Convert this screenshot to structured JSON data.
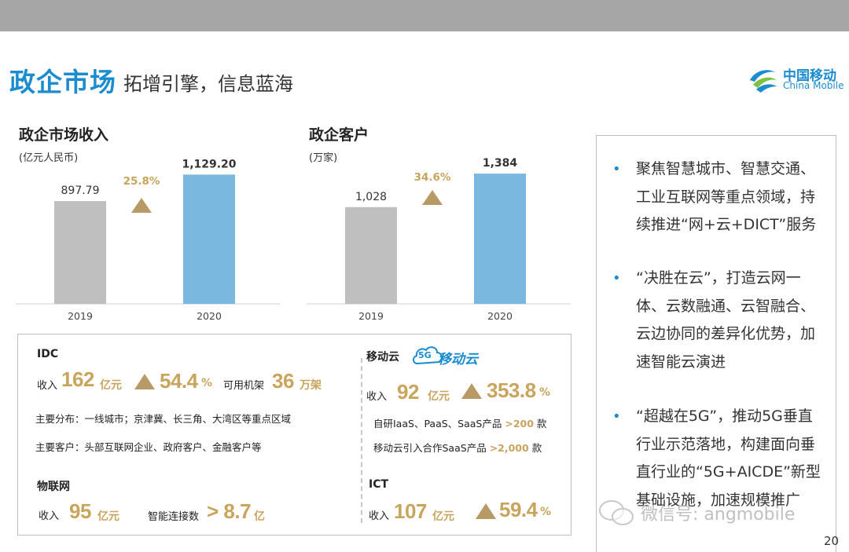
{
  "header": {
    "title_main": "政企市场",
    "title_sub": "拓增引擎，信息蓝海",
    "logo_cn": "中国移动",
    "logo_en": "China Mobile"
  },
  "chart_data": [
    {
      "type": "bar",
      "title": "政企市场收入",
      "ylabel": "(亿元人民币)",
      "categories": [
        "2019",
        "2020"
      ],
      "values": [
        897.79,
        1129.2
      ],
      "value_labels": [
        "897.79",
        "1,129.20"
      ],
      "growth": "25.8%",
      "colors": [
        "#bfbfbf",
        "#7ab8e0"
      ],
      "ylim": [
        0,
        1200
      ]
    },
    {
      "type": "bar",
      "title": "政企客户",
      "ylabel": "(万家)",
      "categories": [
        "2019",
        "2020"
      ],
      "values": [
        1028,
        1384
      ],
      "value_labels": [
        "1,028",
        "1,384"
      ],
      "growth": "34.6%",
      "colors": [
        "#bfbfbf",
        "#7ab8e0"
      ],
      "ylim": [
        0,
        1460
      ]
    }
  ],
  "idc": {
    "title": "IDC",
    "revenue_label": "收入",
    "revenue_value": "162",
    "revenue_unit": "亿元",
    "growth_value": "54.4",
    "growth_unit": "%",
    "racks_label": "可用机架",
    "racks_value": "36",
    "racks_unit": "万架",
    "distribution": "主要分布：一线城市；京津冀、长三角、大湾区等重点区域",
    "customers": "主要客户：头部互联网企业、政府客户、金融客户等"
  },
  "iot": {
    "title": "物联网",
    "revenue_label": "收入",
    "revenue_value": "95",
    "revenue_unit": "亿元",
    "connections_label": "智能连接数",
    "connections_value": "> 8.7",
    "connections_unit": "亿"
  },
  "cloud": {
    "title": "移动云",
    "logo_text": "移动云",
    "logo_badge": "5G",
    "revenue_label": "收入",
    "revenue_value": "92",
    "revenue_unit": "亿元",
    "growth_value": "353.8",
    "growth_unit": "%",
    "line1_text": "自研IaaS、PaaS、SaaS产品",
    "line1_value": ">200",
    "line1_unit": "款",
    "line2_text": "移动云引入合作SaaS产品",
    "line2_value": ">2,000",
    "line2_unit": "款"
  },
  "ict": {
    "title": "ICT",
    "revenue_label": "收入",
    "revenue_value": "107",
    "revenue_unit": "亿元",
    "growth_value": "59.4",
    "growth_unit": "%"
  },
  "side": {
    "bullets": [
      "聚焦智慧城市、智慧交通、工业互联网等重点领域，持续推进“网+云+DICT”服务",
      "“决胜在云”，打造云网一体、云数融通、云智融合、云边协同的差异化优势，加速智能云演进",
      "“超越在5G”，推动5G垂直行业示范落地，构建面向垂直行业的“5G+AICDE”新型基础设施，加速规模推广"
    ]
  },
  "watermark": "微信号: angmobile",
  "page_number": "20"
}
